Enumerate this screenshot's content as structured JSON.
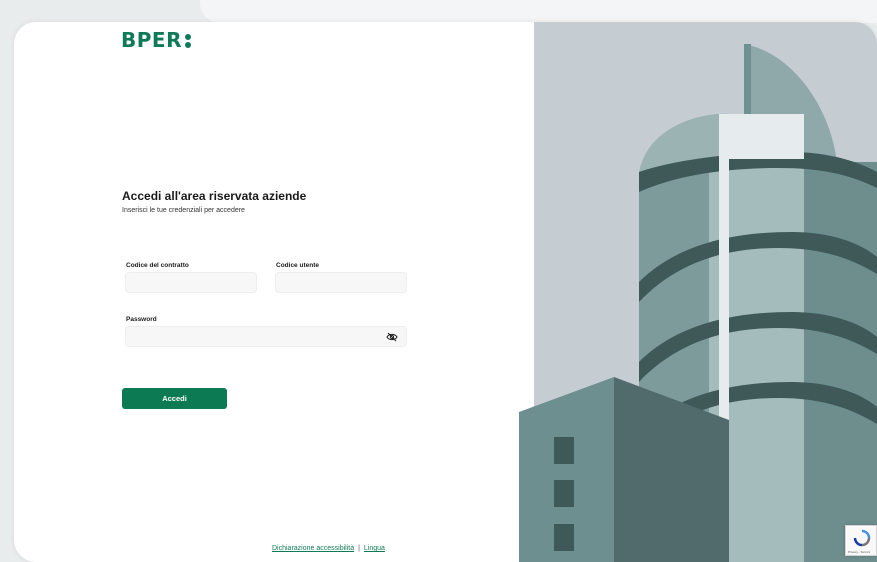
{
  "brand": {
    "logo_text": "BPER",
    "accent_color": "#0f7a57"
  },
  "login": {
    "title": "Accedi all'area riservata aziende",
    "subtitle": "Inserisci le tue credenziali per accedere",
    "contract_code_label": "Codice del contratto",
    "contract_code_value": "",
    "user_code_label": "Codice utente",
    "user_code_value": "",
    "password_label": "Password",
    "password_value": "",
    "password_toggle_icon": "eye-off-icon",
    "submit_label": "Accedi"
  },
  "footer": {
    "accessibility_link": "Dichiarazione accessibilità",
    "separator": "|",
    "language_link": "Lingua"
  },
  "recaptcha": {
    "text": "Privacy - Termini",
    "icon": "recaptcha-icon"
  }
}
